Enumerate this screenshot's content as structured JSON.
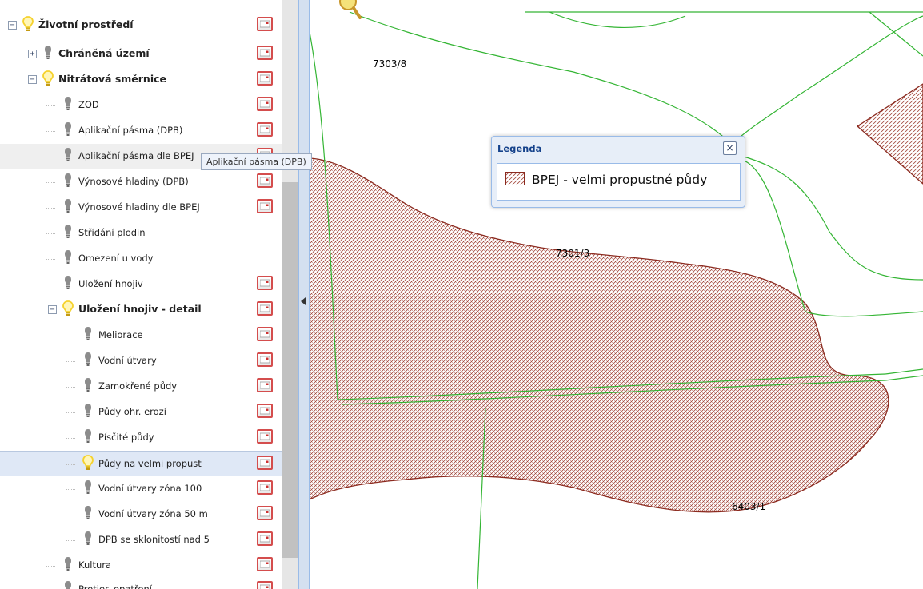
{
  "tree": {
    "items": [
      {
        "label": "Životní prostředí",
        "bold": true,
        "toggle": "−",
        "bulb": "lit",
        "legend_button": true
      },
      {
        "label": "Chráněná území",
        "bold": true,
        "toggle": "+",
        "bulb": "unlit",
        "legend_button": true
      },
      {
        "label": "Nitrátová směrnice",
        "bold": true,
        "toggle": "−",
        "bulb": "lit",
        "legend_button": true
      },
      {
        "label": "ZOD",
        "bold": false,
        "bulb": "unlit",
        "legend_button": true
      },
      {
        "label": "Aplikační pásma (DPB)",
        "bold": false,
        "bulb": "unlit",
        "legend_button": true
      },
      {
        "label": "Aplikační pásma dle BPEJ",
        "bold": false,
        "bulb": "unlit",
        "legend_button": true,
        "hovered": true
      },
      {
        "label": "Výnosové hladiny (DPB)",
        "bold": false,
        "bulb": "unlit",
        "legend_button": true
      },
      {
        "label": "Výnosové hladiny dle BPEJ",
        "bold": false,
        "bulb": "unlit",
        "legend_button": true
      },
      {
        "label": "Střídání plodin",
        "bold": false,
        "bulb": "unlit",
        "legend_button": false
      },
      {
        "label": "Omezení u vody",
        "bold": false,
        "bulb": "unlit",
        "legend_button": false
      },
      {
        "label": "Uložení hnojiv",
        "bold": false,
        "bulb": "unlit",
        "legend_button": true
      },
      {
        "label": "Uložení hnojiv - detail",
        "bold": true,
        "toggle": "−",
        "bulb": "lit",
        "legend_button": true
      },
      {
        "label": "Meliorace",
        "bold": false,
        "bulb": "unlit",
        "legend_button": true
      },
      {
        "label": "Vodní útvary",
        "bold": false,
        "bulb": "unlit",
        "legend_button": true
      },
      {
        "label": "Zamokřené půdy",
        "bold": false,
        "bulb": "unlit",
        "legend_button": true
      },
      {
        "label": "Půdy ohr. erozí",
        "bold": false,
        "bulb": "unlit",
        "legend_button": true
      },
      {
        "label": "Písčité půdy",
        "bold": false,
        "bulb": "unlit",
        "legend_button": true
      },
      {
        "label": "Půdy na velmi propust",
        "bold": false,
        "bulb": "lit",
        "legend_button": true,
        "selected": true
      },
      {
        "label": "Vodní útvary zóna 100",
        "bold": false,
        "bulb": "unlit",
        "legend_button": true
      },
      {
        "label": "Vodní útvary zóna 50 m",
        "bold": false,
        "bulb": "unlit",
        "legend_button": true
      },
      {
        "label": "DPB se sklonitostí nad 5",
        "bold": false,
        "bulb": "unlit",
        "legend_button": true
      },
      {
        "label": "Kultura",
        "bold": false,
        "bulb": "unlit",
        "legend_button": true
      },
      {
        "label": "Protier. opatření",
        "bold": false,
        "bulb": "unlit",
        "legend_button": true
      }
    ]
  },
  "tooltip": {
    "text": "Aplikační pásma (DPB)"
  },
  "legend": {
    "title": "Legenda",
    "close": "×",
    "item_label": "BPEJ - velmi propustné půdy"
  },
  "map": {
    "parcel_labels": [
      "7303/8",
      "7301/3",
      "6403/1"
    ]
  },
  "colors": {
    "parcel_line": "#34b534",
    "polygon_stroke": "#8b2a1f",
    "hatch": "#a3493e",
    "legend_title": "#15428b",
    "bulb_lit": "#f5d22e",
    "bulb_unlit": "#8c8c8c"
  }
}
